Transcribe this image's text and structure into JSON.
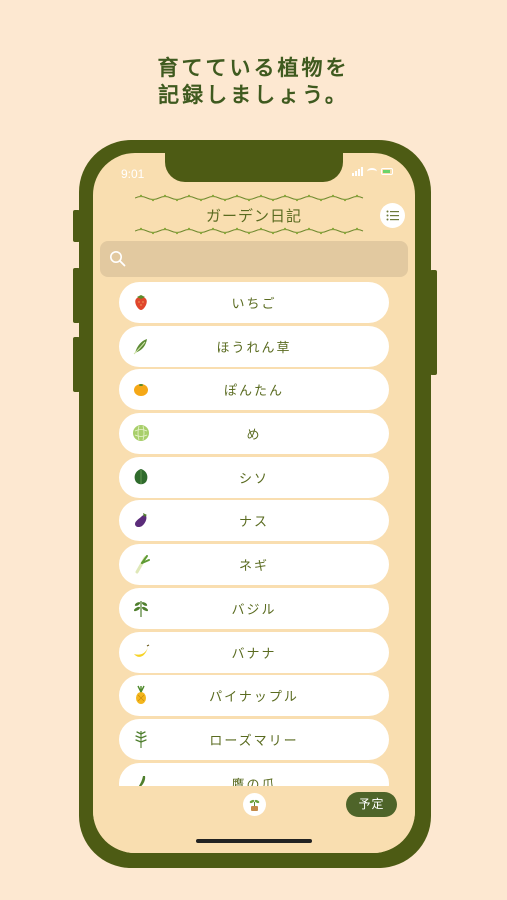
{
  "promo": {
    "line1": "育てている植物を",
    "line2": "記録しましょう。"
  },
  "status": {
    "time": "9:01"
  },
  "header": {
    "title": "ガーデン日記"
  },
  "search": {
    "placeholder": ""
  },
  "plants": [
    {
      "name": "いちご",
      "icon": "strawberry-icon"
    },
    {
      "name": "ほうれん草",
      "icon": "spinach-icon"
    },
    {
      "name": "ぽんたん",
      "icon": "citrus-icon"
    },
    {
      "name": "め",
      "icon": "melon-icon"
    },
    {
      "name": "シソ",
      "icon": "shiso-icon"
    },
    {
      "name": "ナス",
      "icon": "eggplant-icon"
    },
    {
      "name": "ネギ",
      "icon": "leek-icon"
    },
    {
      "name": "バジル",
      "icon": "basil-icon"
    },
    {
      "name": "バナナ",
      "icon": "banana-icon"
    },
    {
      "name": "パイナップル",
      "icon": "pineapple-icon"
    },
    {
      "name": "ローズマリー",
      "icon": "rosemary-icon"
    },
    {
      "name": "鷹の爪",
      "icon": "chili-icon"
    }
  ],
  "bottom": {
    "schedule_label": "予定"
  },
  "colors": {
    "background": "#fde8d1",
    "phone_frame": "#4d5b14",
    "screen": "#f9deb0",
    "accent": "#4e6429",
    "text": "#5a6b20"
  }
}
